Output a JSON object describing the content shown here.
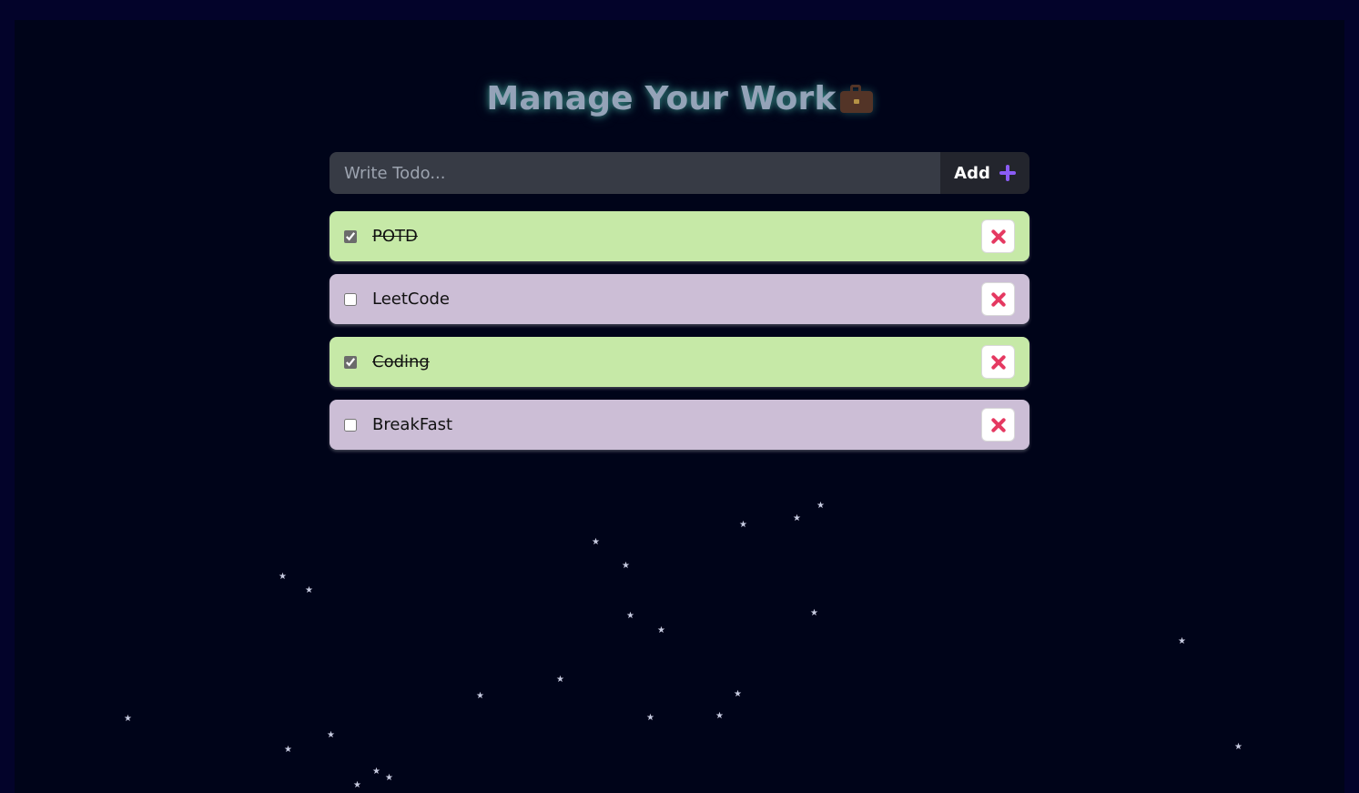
{
  "header": {
    "title": "Manage Your Work"
  },
  "form": {
    "placeholder": "Write Todo...",
    "value": "",
    "add_label": "Add"
  },
  "todos": [
    {
      "text": "POTD",
      "completed": true
    },
    {
      "text": "LeetCode",
      "completed": false
    },
    {
      "text": "Coding",
      "completed": true
    },
    {
      "text": "BreakFast",
      "completed": false
    }
  ],
  "colors": {
    "completed_bg": "#c6e9a7",
    "pending_bg": "#ccbed6",
    "accent": "#8b5cf6",
    "delete": "#e53961",
    "page_bg": "#000419"
  },
  "icons": {
    "title_emoji": "briefcase-icon",
    "add": "plus-icon",
    "delete": "close-icon"
  }
}
